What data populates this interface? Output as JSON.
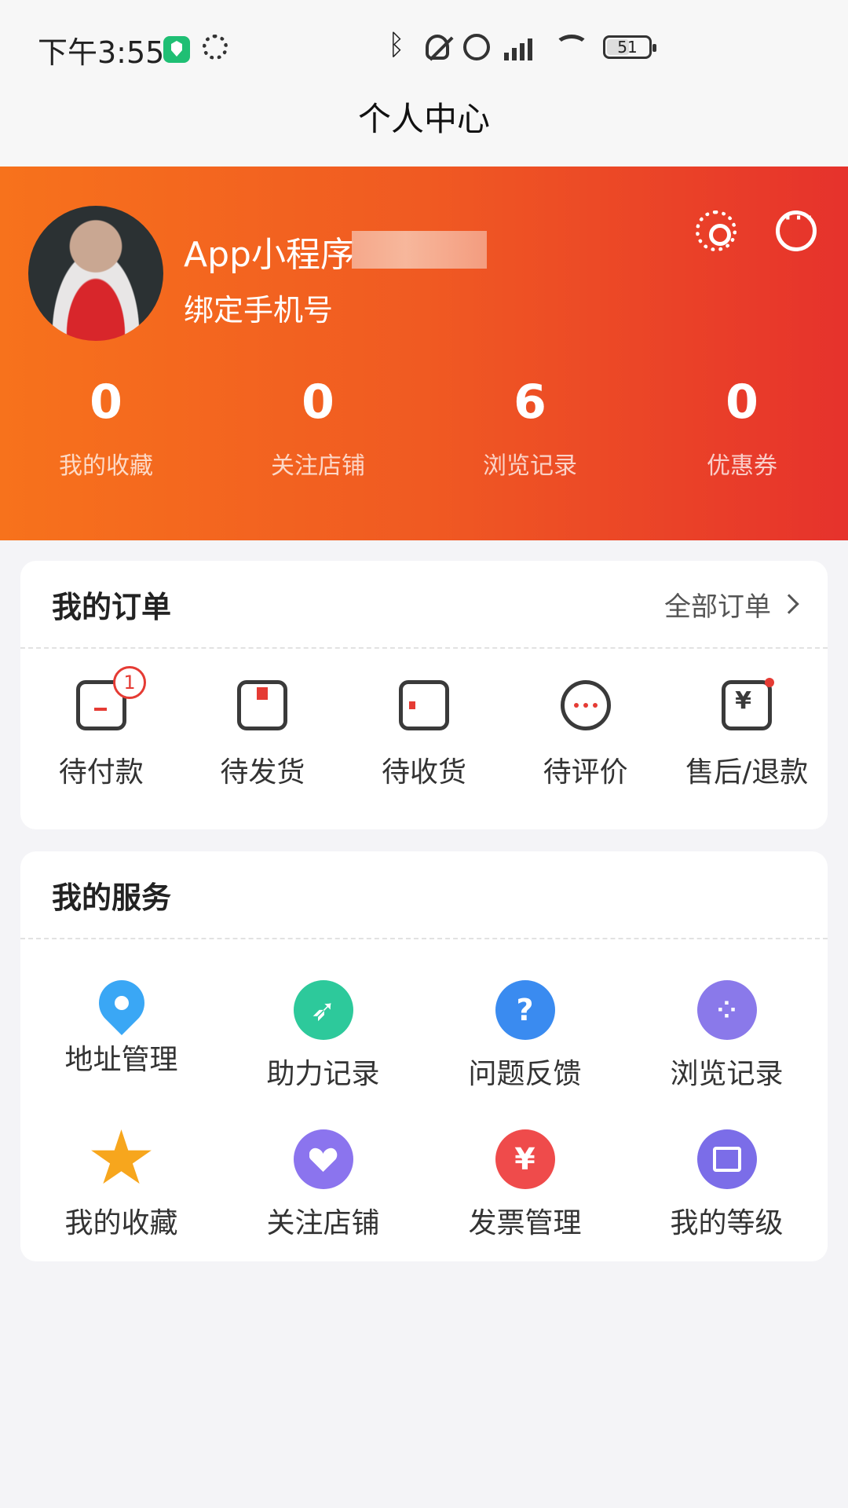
{
  "status_bar": {
    "time": "下午3:55",
    "battery": "51"
  },
  "nav": {
    "title": "个人中心"
  },
  "profile": {
    "username": "App小程序",
    "bind_phone": "绑定手机号"
  },
  "stats": [
    {
      "value": "0",
      "label": "我的收藏"
    },
    {
      "value": "0",
      "label": "关注店铺"
    },
    {
      "value": "6",
      "label": "浏览记录"
    },
    {
      "value": "0",
      "label": "优惠券"
    }
  ],
  "orders": {
    "title": "我的订单",
    "all_label": "全部订单",
    "items": [
      {
        "label": "待付款",
        "badge": "1",
        "icon": "wallet-icon"
      },
      {
        "label": "待发货",
        "icon": "box-icon"
      },
      {
        "label": "待收货",
        "icon": "truck-icon"
      },
      {
        "label": "待评价",
        "icon": "comment-icon"
      },
      {
        "label": "售后/退款",
        "icon": "refund-icon"
      }
    ]
  },
  "services": {
    "title": "我的服务",
    "items": [
      {
        "label": "地址管理",
        "icon": "location-pin-icon",
        "color": "#3aa7f5"
      },
      {
        "label": "助力记录",
        "icon": "rocket-icon",
        "color": "#2dc99b"
      },
      {
        "label": "问题反馈",
        "icon": "question-icon",
        "color": "#3a8bf0"
      },
      {
        "label": "浏览记录",
        "icon": "footprint-icon",
        "color": "#8a79ea"
      },
      {
        "label": "我的收藏",
        "icon": "star-icon",
        "color": "#f7a61d"
      },
      {
        "label": "关注店铺",
        "icon": "heart-icon",
        "color": "#8b74ee"
      },
      {
        "label": "发票管理",
        "icon": "invoice-icon",
        "color": "#ef4b4b"
      },
      {
        "label": "我的等级",
        "icon": "level-scan-icon",
        "color": "#7b6de8"
      }
    ]
  },
  "colors": {
    "header_start": "#f7721c",
    "header_end": "#e6322c",
    "badge": "#e53b34"
  }
}
